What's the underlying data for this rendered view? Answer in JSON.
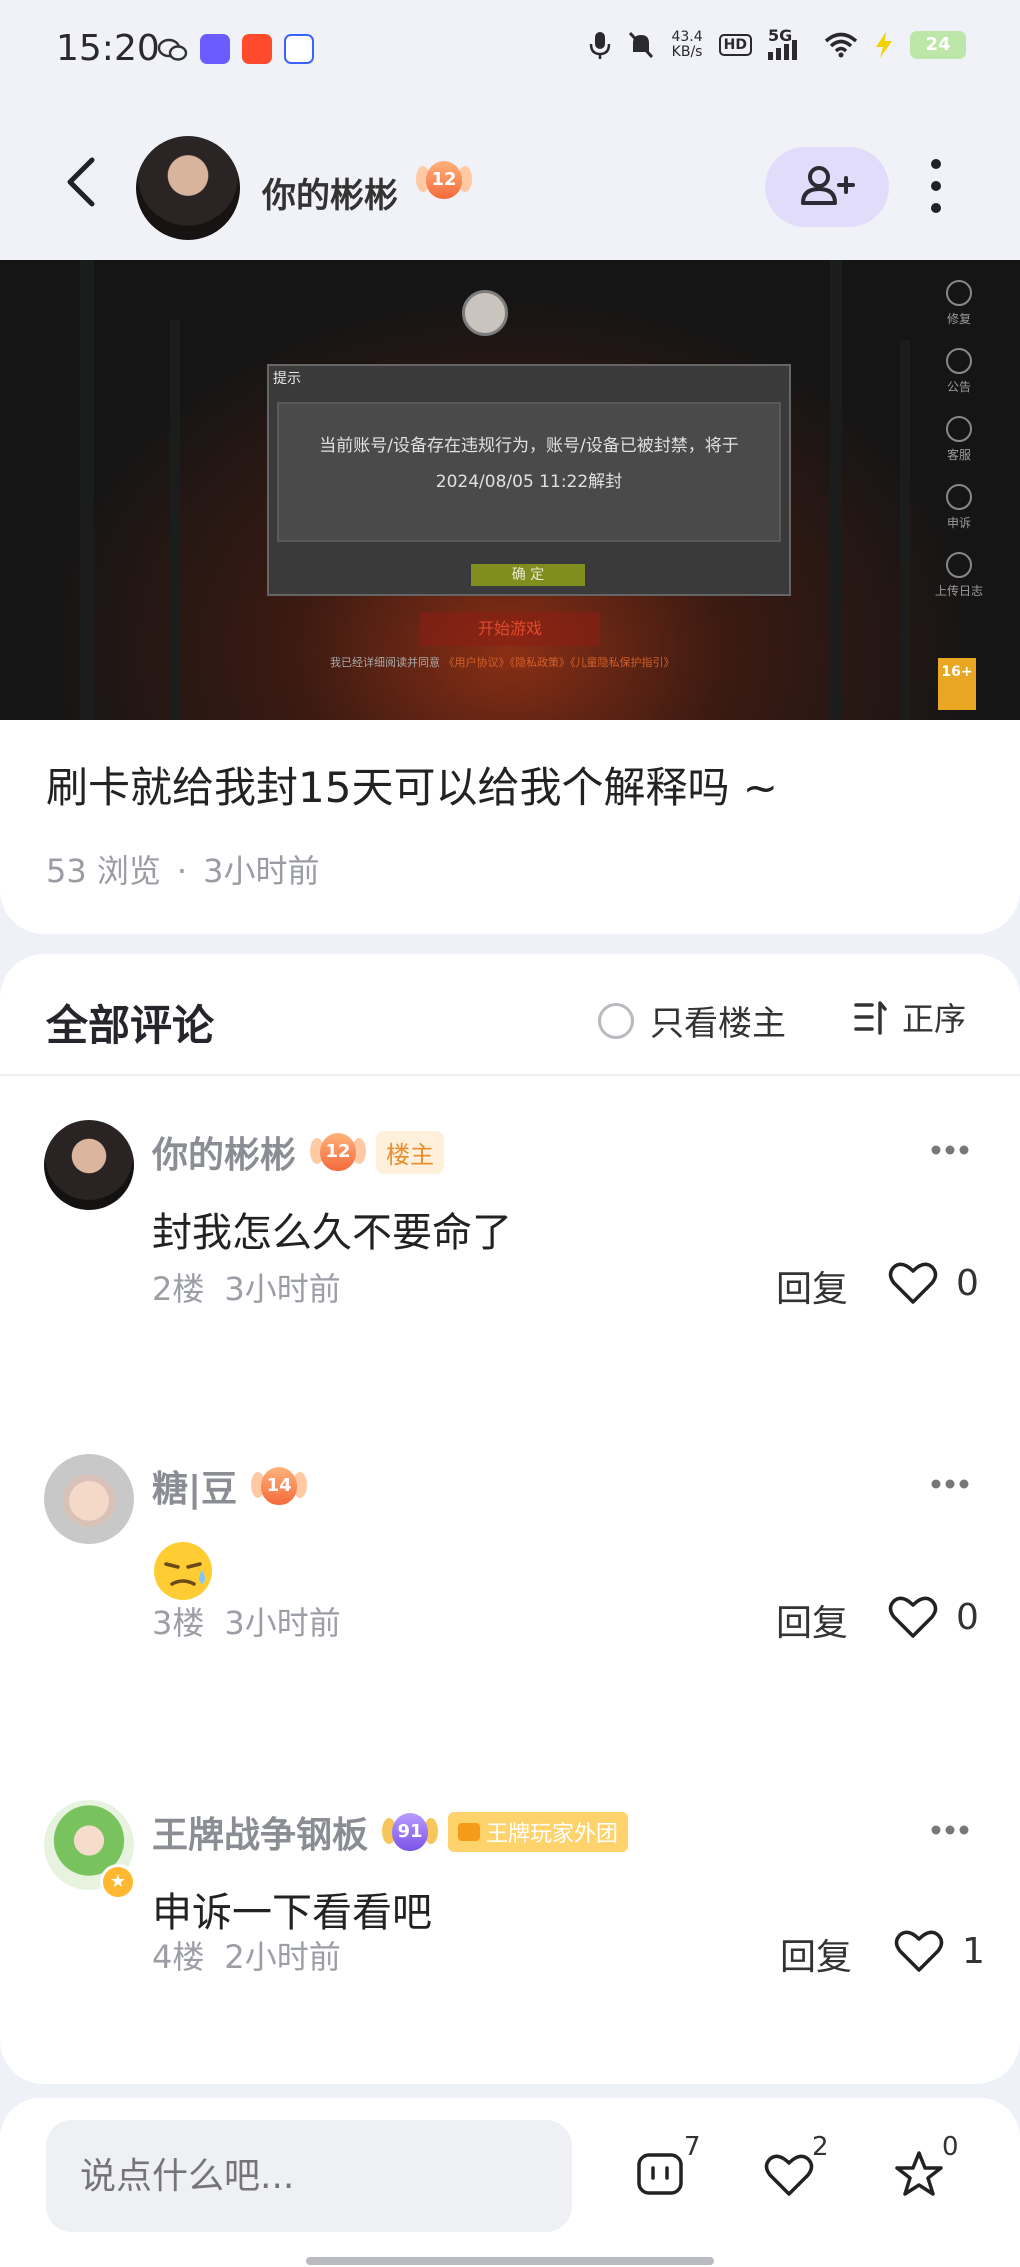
{
  "status_bar": {
    "time": "15:20",
    "net_speed_value": "43.4",
    "net_speed_unit": "KB/s",
    "hd": "HD",
    "signal": "5G",
    "battery": "24",
    "icons": [
      "wechat-icon",
      "app-icon",
      "app-icon",
      "baidu-icon",
      "mic-icon",
      "mute-icon",
      "signal-icon",
      "wifi-icon",
      "charging-icon"
    ]
  },
  "header": {
    "user_name": "你的彬彬",
    "level": "12",
    "follow_icon": "add-user-icon",
    "more_icon": "more-vertical-icon"
  },
  "post": {
    "image": {
      "dialog_title": "提示",
      "dialog_message": "当前账号/设备存在违规行为，账号/设备已被封禁，将于2024/08/05 11:22解封",
      "dialog_ok": "确 定",
      "start_game": "开始游戏",
      "agreement_prefix": "我已经详细阅读并同意",
      "agreement_links": "《用户协议》《隐私政策》《儿童隐私保护指引》",
      "side_menu": [
        "修复",
        "公告",
        "客服",
        "申诉",
        "上传日志"
      ],
      "age_rating": "16+"
    },
    "title": "刷卡就给我封15天可以给我个解释吗 ~",
    "views": "53 浏览",
    "time": "3小时前"
  },
  "comments": {
    "title": "全部评论",
    "only_host": "只看楼主",
    "sort": "正序",
    "reply_label": "回复",
    "items": [
      {
        "name": "你的彬彬",
        "level": "12",
        "tag": "楼主",
        "text": "封我怎么久不要命了",
        "floor": "2楼",
        "time": "3小时前",
        "likes": "0"
      },
      {
        "name": "糖|豆",
        "level": "14",
        "text": "",
        "emoji": "sweat-emoji",
        "floor": "3楼",
        "time": "3小时前",
        "likes": "0"
      },
      {
        "name": "王牌战争钢板",
        "level": "91",
        "tag": "王牌玩家外团",
        "text": "申诉一下看看吧",
        "floor": "4楼",
        "time": "2小时前",
        "likes": "1"
      }
    ]
  },
  "bottom_bar": {
    "placeholder": "说点什么吧...",
    "comment_count": "7",
    "like_count": "2",
    "favorite_count": "0"
  }
}
